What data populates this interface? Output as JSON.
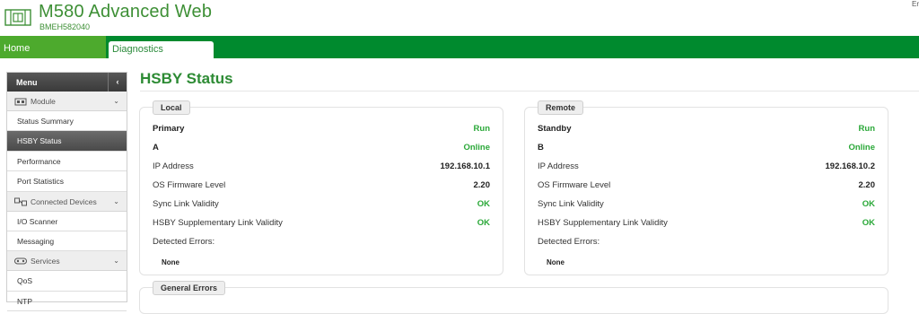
{
  "header": {
    "title": "M580 Advanced Web",
    "subtitle": "BMEH582040",
    "lang": "Er"
  },
  "nav": {
    "home": "Home",
    "diagnostics": "Diagnostics"
  },
  "sidebar": {
    "menu_label": "Menu",
    "collapse_glyph": "‹",
    "sections": [
      {
        "label": "Module",
        "icon": "module-icon",
        "chevron": "⌄"
      },
      {
        "label": "Connected Devices",
        "icon": "devices-icon",
        "chevron": "⌄"
      },
      {
        "label": "Services",
        "icon": "services-icon",
        "chevron": "⌄"
      }
    ],
    "items": [
      {
        "label": "Status Summary"
      },
      {
        "label": "HSBY Status"
      },
      {
        "label": "Performance"
      },
      {
        "label": "Port Statistics"
      },
      {
        "label": "I/O Scanner"
      },
      {
        "label": "Messaging"
      },
      {
        "label": "QoS"
      },
      {
        "label": "NTP"
      }
    ]
  },
  "main": {
    "title": "HSBY Status",
    "local": {
      "legend": "Local",
      "role_key": "Primary",
      "role_val": "Run",
      "unit_key": "A",
      "unit_val": "Online",
      "ip_key": "IP Address",
      "ip_val": "192.168.10.1",
      "fw_key": "OS Firmware Level",
      "fw_val": "2.20",
      "sync_key": "Sync Link Validity",
      "sync_val": "OK",
      "supp_key": "HSBY Supplementary Link Validity",
      "supp_val": "OK",
      "err_key": "Detected Errors:",
      "err_val": "None"
    },
    "remote": {
      "legend": "Remote",
      "role_key": "Standby",
      "role_val": "Run",
      "unit_key": "B",
      "unit_val": "Online",
      "ip_key": "IP Address",
      "ip_val": "192.168.10.2",
      "fw_key": "OS Firmware Level",
      "fw_val": "2.20",
      "sync_key": "Sync Link Validity",
      "sync_val": "OK",
      "supp_key": "HSBY Supplementary Link Validity",
      "supp_val": "OK",
      "err_key": "Detected Errors:",
      "err_val": "None"
    },
    "general_legend": "General Errors"
  },
  "colors": {
    "brand_green": "#008a2e",
    "home_green": "#4daa2d",
    "status_green": "#2aa838",
    "title_green": "#2d8b34"
  }
}
